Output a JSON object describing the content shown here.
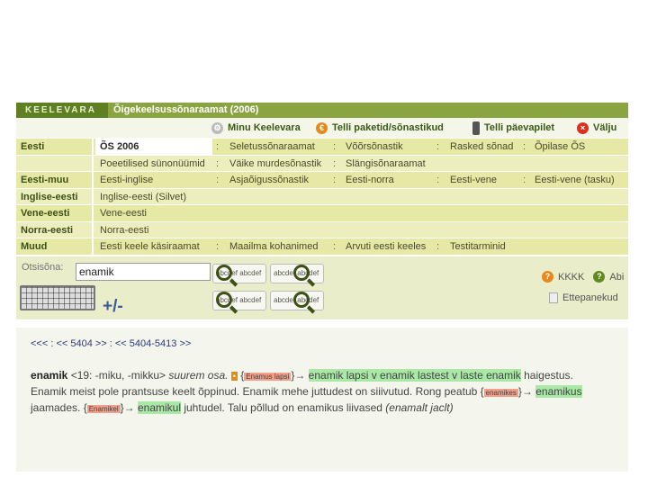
{
  "header": {
    "logo": "KEELEVARA",
    "title": "Õigekeelsussõnaraamat (2006)"
  },
  "topmenu": {
    "items": [
      {
        "label": "Minu Keelevara",
        "icon": "settings-icon"
      },
      {
        "label": "Telli paketid/sõnastikud",
        "icon": "euro-icon"
      },
      {
        "label": "Telli päevapilet",
        "icon": "phone-icon"
      },
      {
        "label": "Välju",
        "icon": "close-icon"
      }
    ]
  },
  "grid": {
    "rows": [
      {
        "cat": "Eesti",
        "cells": [
          "ÕS 2006",
          "Seletussõnaraamat",
          "Võõrsõnastik",
          "Rasked sõnad",
          "Õpilase ÕS"
        ]
      },
      {
        "cat": "",
        "cells": [
          "Poeetilised sünonüümid",
          "Väike murdesõnastik",
          "Slängisõnaraamat"
        ]
      },
      {
        "cat": "Eesti-muu",
        "cells": [
          "Eesti-inglise",
          "Asjaõigussõnastik",
          "Eesti-norra",
          "Eesti-vene",
          "Eesti-vene (tasku)"
        ]
      },
      {
        "cat": "Inglise-eesti",
        "cells": [
          "Inglise-eesti (Silvet)"
        ]
      },
      {
        "cat": "Vene-eesti",
        "cells": [
          "Vene-eesti"
        ]
      },
      {
        "cat": "Norra-eesti",
        "cells": [
          "Norra-eesti"
        ]
      },
      {
        "cat": "Muud",
        "cells": [
          "Eesti keele käsiraamat",
          "Maailma kohanimed",
          "Arvuti eesti keeles",
          "Testitarminid"
        ]
      }
    ],
    "separator": ":"
  },
  "search": {
    "label": "Otsisõna:",
    "value": "enamik",
    "plusminus": "+/-",
    "btn1": "abcdef abcdef",
    "btn2": "abcdef abcdef",
    "help_label": "KKKK",
    "abi_label": "Abi",
    "feedback_label": "Ettepanekud"
  },
  "results": {
    "pager": "<<< : << 5404 >> : << 5404-5413 >>",
    "entry": {
      "headword": "enamik",
      "grammar": "<19: -miku, -mikku>",
      "def": "suurem osa.",
      "tag1": "Enamus lapsi",
      "hl1": "enamik lapsi v enamik lastest v laste enamik",
      "line2": "haigestus. Enamik meist pole prantsuse keelt õppinud. Enamik mehe juttudest on siiivutud. Rong peatub",
      "tag2": "enamikes",
      "hl2": "enamikus",
      "mid2": "jaamades.",
      "tag3": "Enamikel",
      "hl3": "enamikul",
      "end3": "juhtudel. Talu põllud on enamikus liivased",
      "it3": "(enamalt jaclt)"
    }
  },
  "colors": {
    "header": "#8aa442",
    "grid_row": "#e5e9a5",
    "highlight": "#a9e8a6",
    "tag": "#f2a08a"
  }
}
